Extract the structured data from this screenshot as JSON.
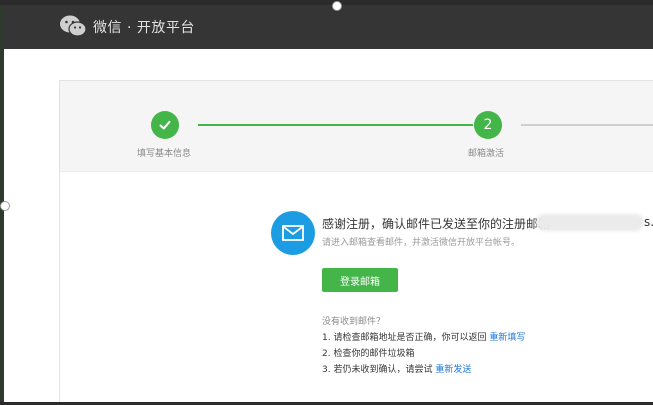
{
  "header": {
    "title": "微信 · 开放平台"
  },
  "steps": [
    {
      "number": "",
      "label": "填写基本信息",
      "status": "done"
    },
    {
      "number": "2",
      "label": "邮箱激活",
      "status": "active"
    }
  ],
  "main": {
    "headline": "感谢注册，确认邮件已发送至你的注册邮箱",
    "email_tail": "s.",
    "subline": "请进入邮箱查看邮件，并激活微信开放平台帐号。",
    "login_button": "登录邮箱"
  },
  "help": {
    "question": "没有收到邮件？",
    "line1_text": "1. 请检查邮箱地址是否正确，你可以返回",
    "line1_link": "重新填写",
    "line2_text": "2. 检查你的邮件垃圾箱",
    "line3_text": "3. 若仍未收到确认，请尝试",
    "line3_link": "重新发送"
  },
  "colors": {
    "topbar": "#353535",
    "accent_green": "#44b549",
    "mail_blue": "#1c9de3",
    "link_blue": "#1f7ad6"
  }
}
